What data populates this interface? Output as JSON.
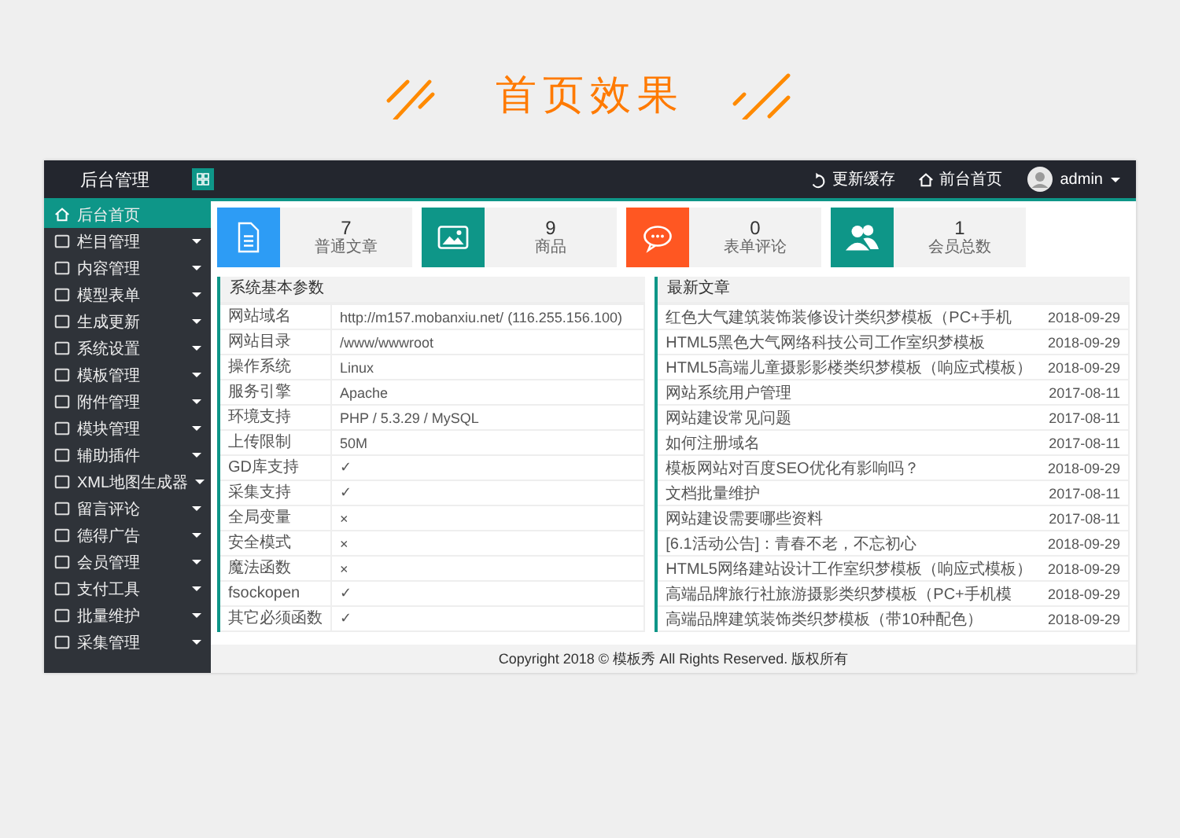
{
  "banner": {
    "title": "首页效果"
  },
  "header": {
    "logo": "后台管理",
    "links": [
      {
        "label": "更新缓存",
        "kind": "refresh"
      },
      {
        "label": "前台首页",
        "kind": "home"
      }
    ],
    "user": "admin"
  },
  "sidebar": {
    "items": [
      {
        "label": "后台首页",
        "selected": true,
        "kind": "home"
      },
      {
        "label": "栏目管理",
        "selected": false,
        "kind": "menu"
      },
      {
        "label": "内容管理",
        "selected": false,
        "kind": "menu"
      },
      {
        "label": "模型表单",
        "selected": false,
        "kind": "menu"
      },
      {
        "label": "生成更新",
        "selected": false,
        "kind": "menu"
      },
      {
        "label": "系统设置",
        "selected": false,
        "kind": "menu"
      },
      {
        "label": "模板管理",
        "selected": false,
        "kind": "menu"
      },
      {
        "label": "附件管理",
        "selected": false,
        "kind": "menu"
      },
      {
        "label": "模块管理",
        "selected": false,
        "kind": "menu"
      },
      {
        "label": "辅助插件",
        "selected": false,
        "kind": "menu"
      },
      {
        "label": "XML地图生成器",
        "selected": false,
        "kind": "menu"
      },
      {
        "label": "留言评论",
        "selected": false,
        "kind": "menu"
      },
      {
        "label": "德得广告",
        "selected": false,
        "kind": "menu"
      },
      {
        "label": "会员管理",
        "selected": false,
        "kind": "menu"
      },
      {
        "label": "支付工具",
        "selected": false,
        "kind": "menu"
      },
      {
        "label": "批量维护",
        "selected": false,
        "kind": "menu"
      },
      {
        "label": "采集管理",
        "selected": false,
        "kind": "menu"
      }
    ]
  },
  "stats": [
    {
      "value": "7",
      "label": "普通文章",
      "kind": "document",
      "color": "#2d9cf5"
    },
    {
      "value": "9",
      "label": "商品",
      "kind": "picture",
      "color": "#0e9688"
    },
    {
      "value": "0",
      "label": "表单评论",
      "kind": "chat",
      "color": "#ff5722"
    },
    {
      "value": "1",
      "label": "会员总数",
      "kind": "users",
      "color": "#0e9688"
    }
  ],
  "system_panel": {
    "title": "系统基本参数",
    "rows": [
      {
        "label": "网站域名",
        "value": "http://m157.mobanxiu.net/ (116.255.156.100)"
      },
      {
        "label": "网站目录",
        "value": "/www/wwwroot"
      },
      {
        "label": "操作系统",
        "value": "Linux"
      },
      {
        "label": "服务引擎",
        "value": "Apache"
      },
      {
        "label": "环境支持",
        "value": "PHP / 5.3.29 / MySQL"
      },
      {
        "label": "上传限制",
        "value": "50M"
      },
      {
        "label": "GD库支持",
        "value": "✓"
      },
      {
        "label": "采集支持",
        "value": "✓"
      },
      {
        "label": "全局变量",
        "value": "×"
      },
      {
        "label": "安全模式",
        "value": "×"
      },
      {
        "label": "魔法函数",
        "value": "×"
      },
      {
        "label": "fsockopen",
        "value": "✓"
      },
      {
        "label": "其它必须函数",
        "value": "✓"
      }
    ]
  },
  "articles_panel": {
    "title": "最新文章",
    "rows": [
      {
        "title": "红色大气建筑装饰装修设计类织梦模板（PC+手机",
        "date": "2018-09-29"
      },
      {
        "title": "HTML5黑色大气网络科技公司工作室织梦模板",
        "date": "2018-09-29"
      },
      {
        "title": "HTML5高端儿童摄影影楼类织梦模板（响应式模板）",
        "date": "2018-09-29"
      },
      {
        "title": "网站系统用户管理",
        "date": "2017-08-11"
      },
      {
        "title": "网站建设常见问题",
        "date": "2017-08-11"
      },
      {
        "title": "如何注册域名",
        "date": "2017-08-11"
      },
      {
        "title": "模板网站对百度SEO优化有影响吗？",
        "date": "2018-09-29"
      },
      {
        "title": "文档批量维护",
        "date": "2017-08-11"
      },
      {
        "title": "网站建设需要哪些资料",
        "date": "2017-08-11"
      },
      {
        "title": "[6.1活动公告]：青春不老，不忘初心",
        "date": "2018-09-29"
      },
      {
        "title": "HTML5网络建站设计工作室织梦模板（响应式模板）",
        "date": "2018-09-29"
      },
      {
        "title": "高端品牌旅行社旅游摄影类织梦模板（PC+手机模",
        "date": "2018-09-29"
      },
      {
        "title": "高端品牌建筑装饰类织梦模板（带10种配色）",
        "date": "2018-09-29"
      }
    ]
  },
  "footer": {
    "text": "Copyright 2018 © 模板秀 All Rights Reserved. 版权所有"
  }
}
